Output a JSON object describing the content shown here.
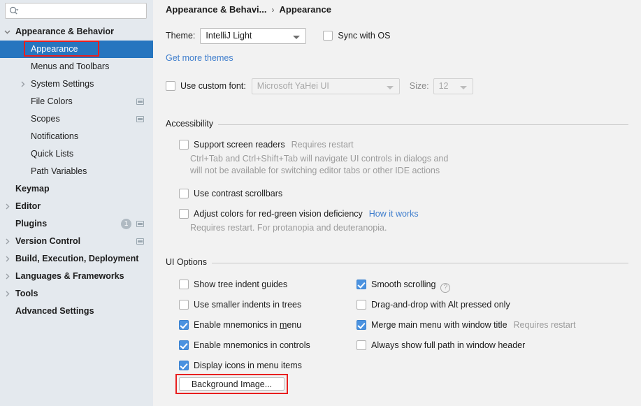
{
  "search": {
    "placeholder": "",
    "icon": "search-icon"
  },
  "sidebar": {
    "items": [
      {
        "label": "Appearance & Behavior",
        "bold": true,
        "indent": 22,
        "arrow": "down",
        "selected": false,
        "icon": false,
        "badge": null
      },
      {
        "label": "Appearance",
        "bold": false,
        "indent": 44,
        "arrow": "none",
        "selected": true,
        "icon": false,
        "badge": null
      },
      {
        "label": "Menus and Toolbars",
        "bold": false,
        "indent": 44,
        "arrow": "none",
        "selected": false,
        "icon": false,
        "badge": null
      },
      {
        "label": "System Settings",
        "bold": false,
        "indent": 44,
        "arrow": "right",
        "selected": false,
        "icon": false,
        "badge": null
      },
      {
        "label": "File Colors",
        "bold": false,
        "indent": 44,
        "arrow": "none",
        "selected": false,
        "icon": true,
        "badge": null
      },
      {
        "label": "Scopes",
        "bold": false,
        "indent": 44,
        "arrow": "none",
        "selected": false,
        "icon": true,
        "badge": null
      },
      {
        "label": "Notifications",
        "bold": false,
        "indent": 44,
        "arrow": "none",
        "selected": false,
        "icon": false,
        "badge": null
      },
      {
        "label": "Quick Lists",
        "bold": false,
        "indent": 44,
        "arrow": "none",
        "selected": false,
        "icon": false,
        "badge": null
      },
      {
        "label": "Path Variables",
        "bold": false,
        "indent": 44,
        "arrow": "none",
        "selected": false,
        "icon": false,
        "badge": null
      },
      {
        "label": "Keymap",
        "bold": true,
        "indent": 22,
        "arrow": "none",
        "selected": false,
        "icon": false,
        "badge": null
      },
      {
        "label": "Editor",
        "bold": true,
        "indent": 22,
        "arrow": "right",
        "selected": false,
        "icon": false,
        "badge": null
      },
      {
        "label": "Plugins",
        "bold": true,
        "indent": 22,
        "arrow": "none",
        "selected": false,
        "icon": true,
        "badge": "1"
      },
      {
        "label": "Version Control",
        "bold": true,
        "indent": 22,
        "arrow": "right",
        "selected": false,
        "icon": true,
        "badge": null
      },
      {
        "label": "Build, Execution, Deployment",
        "bold": true,
        "indent": 22,
        "arrow": "right",
        "selected": false,
        "icon": false,
        "badge": null
      },
      {
        "label": "Languages & Frameworks",
        "bold": true,
        "indent": 22,
        "arrow": "right",
        "selected": false,
        "icon": false,
        "badge": null
      },
      {
        "label": "Tools",
        "bold": true,
        "indent": 22,
        "arrow": "right",
        "selected": false,
        "icon": false,
        "badge": null
      },
      {
        "label": "Advanced Settings",
        "bold": true,
        "indent": 22,
        "arrow": "none",
        "selected": false,
        "icon": false,
        "badge": null
      }
    ]
  },
  "breadcrumb": {
    "parent": "Appearance & Behavi...",
    "separator": "›",
    "current": "Appearance"
  },
  "theme": {
    "label": "Theme:",
    "value": "IntelliJ Light",
    "sync_label": "Sync with OS",
    "sync_checked": false,
    "get_more_themes": "Get more themes"
  },
  "font": {
    "use_custom_label": "Use custom font:",
    "use_custom_checked": false,
    "family_value": "Microsoft YaHei UI",
    "size_label": "Size:",
    "size_value": "12"
  },
  "accessibility": {
    "title": "Accessibility",
    "items": [
      {
        "label": "Support screen readers",
        "checked": false,
        "hint": "Requires restart",
        "desc": [
          "Ctrl+Tab and Ctrl+Shift+Tab will navigate UI controls in dialogs and",
          "will not be available for switching editor tabs or other IDE actions"
        ]
      },
      {
        "label": "Use contrast scrollbars",
        "checked": false,
        "hint": "",
        "desc": []
      },
      {
        "label": "Adjust colors for red-green vision deficiency",
        "checked": false,
        "link": "How it works",
        "desc": [
          "Requires restart. For protanopia and deuteranopia."
        ]
      }
    ]
  },
  "ui_options": {
    "title": "UI Options",
    "left": [
      {
        "label": "Show tree indent guides",
        "checked": false,
        "mnemonic": ""
      },
      {
        "label": "Use smaller indents in trees",
        "checked": false,
        "mnemonic": ""
      },
      {
        "label": "Enable mnemonics in menu",
        "checked": true,
        "mnemonic": "m"
      },
      {
        "label": "Enable mnemonics in controls",
        "checked": true,
        "mnemonic": ""
      },
      {
        "label": "Display icons in menu items",
        "checked": true,
        "mnemonic": ""
      }
    ],
    "right": [
      {
        "label": "Smooth scrolling",
        "checked": true,
        "help": true,
        "hint": ""
      },
      {
        "label": "Drag-and-drop with Alt pressed only",
        "checked": false,
        "help": false,
        "hint": ""
      },
      {
        "label": "Merge main menu with window title",
        "checked": true,
        "help": false,
        "hint": "Requires restart"
      },
      {
        "label": "Always show full path in window header",
        "checked": false,
        "help": false,
        "hint": ""
      }
    ],
    "background_image_button": "Background Image..."
  },
  "colors": {
    "selection_blue": "#2675bf",
    "checkbox_blue": "#4a92e0",
    "link_blue": "#3f7ecd",
    "annotation_red": "#e81f1f",
    "sidebar_bg": "#e4e9ee",
    "main_bg": "#f2f2f2"
  }
}
